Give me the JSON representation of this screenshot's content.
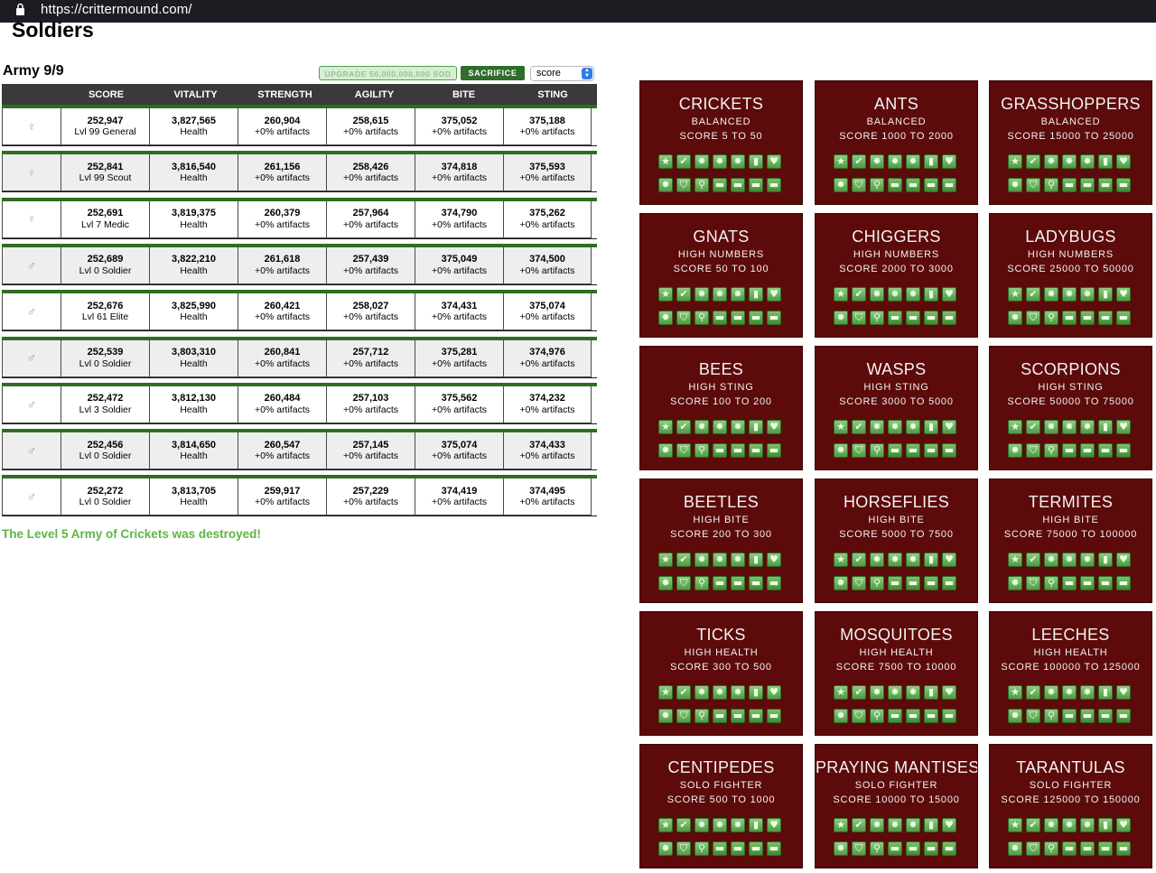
{
  "browser": {
    "url": "https://crittermound.com/"
  },
  "page": {
    "title": "Soldiers"
  },
  "army": {
    "title": "Army 9/9",
    "upgrade_label": "UPGRADE 50,000,000,000 SOD",
    "sacrifice_label": "SACRIFICE",
    "sort_value": "score",
    "columns": [
      "",
      "SCORE",
      "VITALITY",
      "STRENGTH",
      "AGILITY",
      "BITE",
      "STING"
    ],
    "rows": [
      {
        "gender": "female",
        "score": "252,947",
        "rank": "Lvl 99 General",
        "vitality": "3,827,565",
        "vitality_sub": "Health",
        "strength": "260,904",
        "agility": "258,615",
        "bite": "375,052",
        "sting": "375,188",
        "sub": "+0% artifacts"
      },
      {
        "gender": "female",
        "score": "252,841",
        "rank": "Lvl 99 Scout",
        "vitality": "3,816,540",
        "vitality_sub": "Health",
        "strength": "261,156",
        "agility": "258,426",
        "bite": "374,818",
        "sting": "375,593",
        "sub": "+0% artifacts"
      },
      {
        "gender": "female",
        "score": "252,691",
        "rank": "Lvl 7 Medic",
        "vitality": "3,819,375",
        "vitality_sub": "Health",
        "strength": "260,379",
        "agility": "257,964",
        "bite": "374,790",
        "sting": "375,262",
        "sub": "+0% artifacts"
      },
      {
        "gender": "male",
        "score": "252,689",
        "rank": "Lvl 0 Soldier",
        "vitality": "3,822,210",
        "vitality_sub": "Health",
        "strength": "261,618",
        "agility": "257,439",
        "bite": "375,049",
        "sting": "374,500",
        "sub": "+0% artifacts"
      },
      {
        "gender": "male",
        "score": "252,676",
        "rank": "Lvl 61 Elite",
        "vitality": "3,825,990",
        "vitality_sub": "Health",
        "strength": "260,421",
        "agility": "258,027",
        "bite": "374,431",
        "sting": "375,074",
        "sub": "+0% artifacts"
      },
      {
        "gender": "male",
        "score": "252,539",
        "rank": "Lvl 0 Soldier",
        "vitality": "3,803,310",
        "vitality_sub": "Health",
        "strength": "260,841",
        "agility": "257,712",
        "bite": "375,281",
        "sting": "374,976",
        "sub": "+0% artifacts"
      },
      {
        "gender": "male",
        "score": "252,472",
        "rank": "Lvl 3 Soldier",
        "vitality": "3,812,130",
        "vitality_sub": "Health",
        "strength": "260,484",
        "agility": "257,103",
        "bite": "375,562",
        "sting": "374,232",
        "sub": "+0% artifacts"
      },
      {
        "gender": "male",
        "score": "252,456",
        "rank": "Lvl 0 Soldier",
        "vitality": "3,814,650",
        "vitality_sub": "Health",
        "strength": "260,547",
        "agility": "257,145",
        "bite": "375,074",
        "sting": "374,433",
        "sub": "+0% artifacts"
      },
      {
        "gender": "male",
        "score": "252,272",
        "rank": "Lvl 0 Soldier",
        "vitality": "3,813,705",
        "vitality_sub": "Health",
        "strength": "259,917",
        "agility": "257,229",
        "bite": "374,419",
        "sting": "374,495",
        "sub": "+0% artifacts"
      }
    ],
    "gender_symbols": {
      "female": "♀",
      "male": "♂"
    },
    "message": "The Level 5 Army of Crickets was destroyed!"
  },
  "enemies": [
    {
      "name": "CRICKETS",
      "type": "BALANCED",
      "range": "SCORE 5 TO 50"
    },
    {
      "name": "ANTS",
      "type": "BALANCED",
      "range": "SCORE 1000 TO 2000"
    },
    {
      "name": "GRASSHOPPERS",
      "type": "BALANCED",
      "range": "SCORE 15000 TO 25000"
    },
    {
      "name": "GNATS",
      "type": "HIGH NUMBERS",
      "range": "SCORE 50 TO 100"
    },
    {
      "name": "CHIGGERS",
      "type": "HIGH NUMBERS",
      "range": "SCORE 2000 TO 3000"
    },
    {
      "name": "LADYBUGS",
      "type": "HIGH NUMBERS",
      "range": "SCORE 25000 TO 50000"
    },
    {
      "name": "BEES",
      "type": "HIGH STING",
      "range": "SCORE 100 TO 200"
    },
    {
      "name": "WASPS",
      "type": "HIGH STING",
      "range": "SCORE 3000 TO 5000"
    },
    {
      "name": "SCORPIONS",
      "type": "HIGH STING",
      "range": "SCORE 50000 TO 75000"
    },
    {
      "name": "BEETLES",
      "type": "HIGH BITE",
      "range": "SCORE 200 TO 300"
    },
    {
      "name": "HORSEFLIES",
      "type": "HIGH BITE",
      "range": "SCORE 5000 TO 7500"
    },
    {
      "name": "TERMITES",
      "type": "HIGH BITE",
      "range": "SCORE 75000 TO 100000"
    },
    {
      "name": "TICKS",
      "type": "HIGH HEALTH",
      "range": "SCORE 300 TO 500"
    },
    {
      "name": "MOSQUITOES",
      "type": "HIGH HEALTH",
      "range": "SCORE 7500 TO 10000"
    },
    {
      "name": "LEECHES",
      "type": "HIGH HEALTH",
      "range": "SCORE 100000 TO 125000"
    },
    {
      "name": "CENTIPEDES",
      "type": "SOLO FIGHTER",
      "range": "SCORE 500 TO 1000"
    },
    {
      "name": "PRAYING MANTISES",
      "type": "SOLO FIGHTER",
      "range": "SCORE 10000 TO 15000"
    },
    {
      "name": "TARANTULAS",
      "type": "SOLO FIGHTER",
      "range": "SCORE 125000 TO 150000"
    }
  ],
  "reward_icons": {
    "row1": [
      {
        "name": "star-icon",
        "glyph": "★"
      },
      {
        "name": "check-badge-icon",
        "glyph": "✔"
      },
      {
        "name": "burst-star-icon",
        "glyph": "✸"
      },
      {
        "name": "burst-star-icon",
        "glyph": "✸"
      },
      {
        "name": "burst-star-icon",
        "glyph": "✸"
      },
      {
        "name": "scroll-icon",
        "glyph": "▮"
      },
      {
        "name": "heart-icon",
        "glyph": "♥"
      }
    ],
    "row2": [
      {
        "name": "gear-icon",
        "glyph": "✹"
      },
      {
        "name": "shield-icon",
        "glyph": "⛉"
      },
      {
        "name": "magnifier-icon",
        "glyph": "⚲"
      },
      {
        "name": "block-icon",
        "glyph": "▬"
      },
      {
        "name": "block-icon",
        "glyph": "▬"
      },
      {
        "name": "block-icon",
        "glyph": "▬"
      },
      {
        "name": "block-icon",
        "glyph": "▬"
      }
    ]
  },
  "colors": {
    "card_bg": "#5c0a0a",
    "row_bar": "#2f6d23",
    "message": "#5fb444",
    "sacrifice": "#2e6e2a"
  }
}
